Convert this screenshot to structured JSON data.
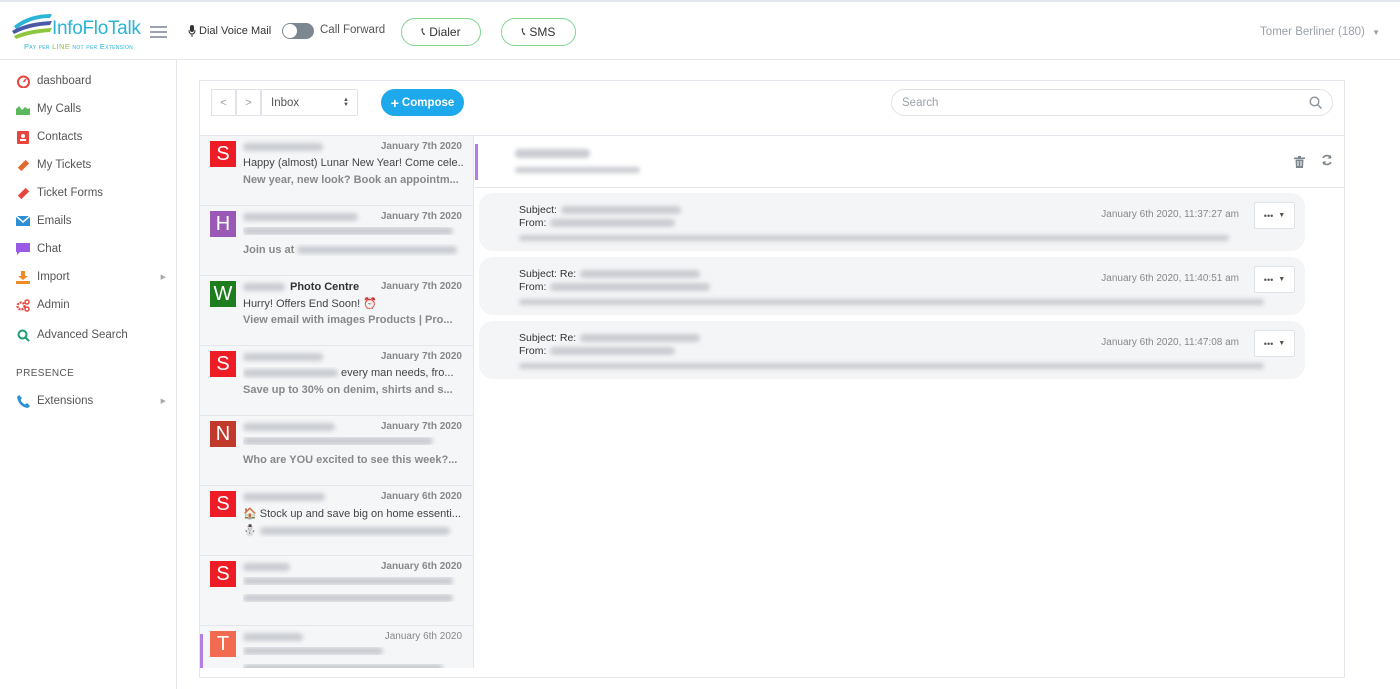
{
  "header": {
    "logo_text": "InfoFloTalk",
    "logo_tagline_prefix": "Pay per ",
    "logo_tagline_highlight": "LINE",
    "logo_tagline_suffix": " not per Extension",
    "dial_voice_mail_label": "Dial Voice Mail",
    "call_forward_label": "Call Forward",
    "call_forward_on": false,
    "dialer_label": "Dialer",
    "sms_label": "SMS",
    "user_label": "Tomer Berliner (180)",
    "accent_green": "#7fd68f"
  },
  "sidebar": {
    "items": [
      {
        "label": "dashboard",
        "icon": "speedometer-icon",
        "color": "#e8453c"
      },
      {
        "label": "My Calls",
        "icon": "area-chart-icon",
        "color": "#5cb85c"
      },
      {
        "label": "Contacts",
        "icon": "address-book-icon",
        "color": "#e8453c"
      },
      {
        "label": "My Tickets",
        "icon": "ticket-icon",
        "color": "#e26a2c"
      },
      {
        "label": "Ticket Forms",
        "icon": "ticket-icon",
        "color": "#e8453c"
      },
      {
        "label": "Emails",
        "icon": "envelope-icon",
        "color": "#2d8fd5"
      },
      {
        "label": "Chat",
        "icon": "chat-icon",
        "color": "#9b59e6"
      },
      {
        "label": "Import",
        "icon": "download-icon",
        "color": "#f08a24",
        "has_submenu": true
      },
      {
        "label": "Admin",
        "icon": "gears-icon",
        "color": "#e8453c"
      },
      {
        "label": "Advanced Search",
        "icon": "search-icon",
        "color": "#1a9e6e"
      }
    ],
    "presence_label": "PRESENCE",
    "presence_items": [
      {
        "label": "Extensions",
        "icon": "phone-icon",
        "color": "#2d8fd5",
        "has_submenu": true
      }
    ]
  },
  "toolbar": {
    "prev_label": "<",
    "next_label": ">",
    "folder_selected": "Inbox",
    "compose_label": "Compose",
    "search_placeholder": "Search",
    "compose_color": "#1ea9ec"
  },
  "email_list": [
    {
      "avatar": "S",
      "color": "#ee1c25",
      "sender_suffix": "",
      "date": "January 7th 2020",
      "line2": "Happy (almost) Lunar New Year! Come cele...",
      "line3": "New year, new look? Book an appointm..."
    },
    {
      "avatar": "H",
      "color": "#9b59b6",
      "sender_suffix": "",
      "date": "January 7th 2020",
      "line2": "",
      "line3": "Join us at"
    },
    {
      "avatar": "W",
      "color": "#1e7d1e",
      "sender_suffix": "Photo Centre",
      "date": "January 7th 2020",
      "line2": "Hurry! Offers End Soon! ⏰",
      "line3": "View email with images Products | Pro..."
    },
    {
      "avatar": "S",
      "color": "#ee1c25",
      "sender_suffix": "",
      "date": "January 7th 2020",
      "line2": "every man needs, fro...",
      "line3": "Save up to 30% on denim, shirts and s..."
    },
    {
      "avatar": "N",
      "color": "#c0392b",
      "sender_suffix": "",
      "date": "January 7th 2020",
      "line2": "",
      "line3": "Who are YOU excited to see this week?..."
    },
    {
      "avatar": "S",
      "color": "#ee1c25",
      "sender_suffix": "",
      "date": "January 6th 2020",
      "line2": "🏠 Stock up and save big on home essenti...",
      "line3": "⛄"
    },
    {
      "avatar": "S",
      "color": "#ee1c25",
      "sender_suffix": "",
      "date": "January 6th 2020",
      "line2": "",
      "line3": ""
    },
    {
      "avatar": "T",
      "color": "#f26a4f",
      "sender_suffix": "",
      "date": "January 6th 2020",
      "line2": "",
      "line3": "",
      "active": true
    }
  ],
  "thread": {
    "subject_label": "Subject:",
    "subject_re_label": "Subject: Re:",
    "from_label": "From:",
    "messages": [
      {
        "subject_prefix": "Subject:",
        "timestamp": "January 6th 2020, 11:37:27 am",
        "more_label": "•••"
      },
      {
        "subject_prefix": "Subject: Re:",
        "timestamp": "January 6th 2020, 11:40:51 am",
        "more_label": "•••"
      },
      {
        "subject_prefix": "Subject: Re:",
        "timestamp": "January 6th 2020, 11:47:08 am",
        "more_label": "•••"
      }
    ]
  }
}
